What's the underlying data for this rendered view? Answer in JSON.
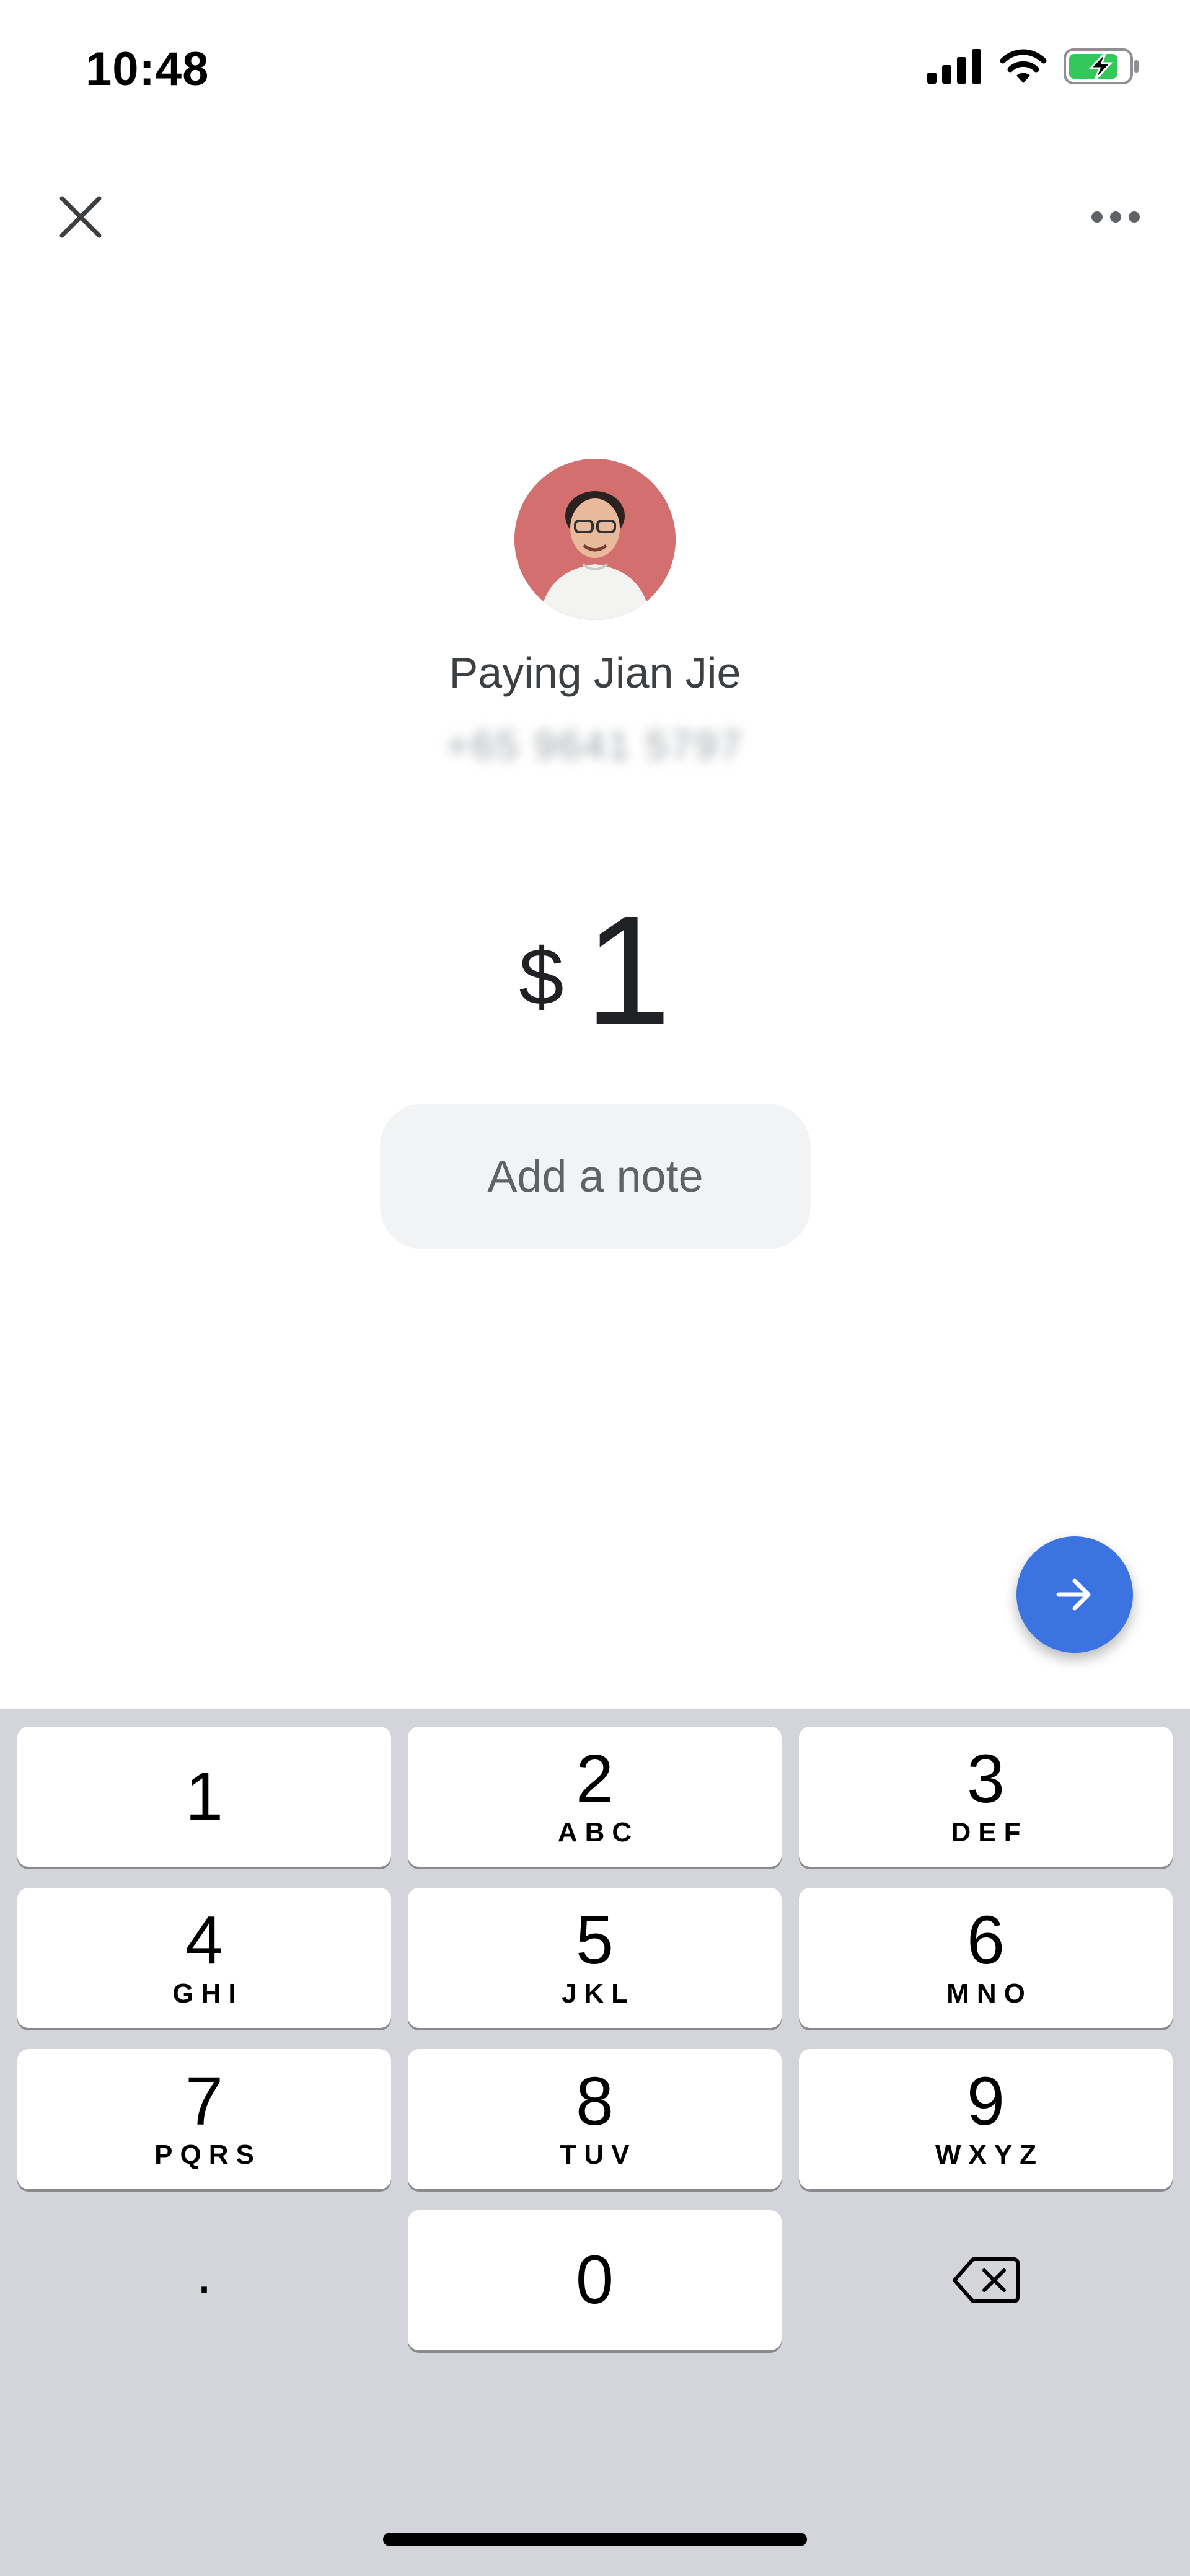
{
  "status_bar": {
    "time": "10:48",
    "battery": "charging"
  },
  "header": {
    "close_icon": "close-icon",
    "more_icon": "more-horizontal-icon"
  },
  "payee": {
    "paying_label": "Paying Jian Jie",
    "phone_number": "+65 9641 5797"
  },
  "amount": {
    "currency": "$",
    "value": "1"
  },
  "note": {
    "label": "Add a note"
  },
  "keypad": {
    "keys": [
      {
        "digit": "1",
        "letters": ""
      },
      {
        "digit": "2",
        "letters": "ABC"
      },
      {
        "digit": "3",
        "letters": "DEF"
      },
      {
        "digit": "4",
        "letters": "GHI"
      },
      {
        "digit": "5",
        "letters": "JKL"
      },
      {
        "digit": "6",
        "letters": "MNO"
      },
      {
        "digit": "7",
        "letters": "PQRS"
      },
      {
        "digit": "8",
        "letters": "TUV"
      },
      {
        "digit": "9",
        "letters": "WXYZ"
      },
      {
        "digit": "0",
        "letters": ""
      }
    ],
    "decimal": ".",
    "backspace_icon": "backspace-icon"
  },
  "colors": {
    "accent": "#3b73e0",
    "keypad_bg": "#d3d5da",
    "avatar_bg": "#d46f6f",
    "battery_green": "#34c759"
  }
}
